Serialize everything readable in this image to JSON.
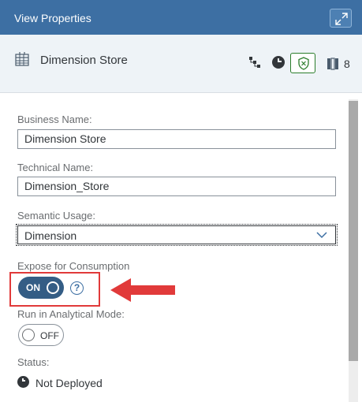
{
  "header": {
    "title": "View Properties"
  },
  "object": {
    "name": "Dimension Store",
    "column_count": "8"
  },
  "fields": {
    "business_name": {
      "label": "Business Name:",
      "value": "Dimension Store"
    },
    "technical_name": {
      "label": "Technical Name:",
      "value": "Dimension_Store"
    },
    "semantic_usage": {
      "label": "Semantic Usage:",
      "value": "Dimension"
    }
  },
  "expose": {
    "label": "Expose for Consumption",
    "toggle_text": "ON",
    "help": "?"
  },
  "analytical": {
    "label": "Run in Analytical Mode:",
    "toggle_text": "OFF"
  },
  "status": {
    "label": "Status:",
    "value": "Not Deployed"
  },
  "colors": {
    "header_bg": "#3d6fa3",
    "object_bar_bg": "#eef3f7",
    "toggle_on": "#345d85",
    "highlight": "#e13a3a",
    "shield_green": "#2b7d2b"
  },
  "icons": [
    "table-icon",
    "hierarchy-icon",
    "clock-icon",
    "shield-icon",
    "columns-icon",
    "expand-icon",
    "chevron-down-icon",
    "help-icon",
    "status-clock-icon"
  ]
}
